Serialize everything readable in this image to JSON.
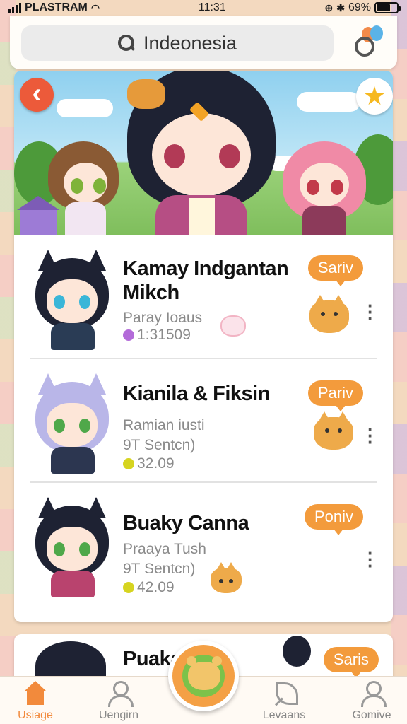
{
  "status_bar": {
    "carrier": "PLASTRAM",
    "time": "11:31",
    "battery": "69%",
    "battery_level": 0.69
  },
  "search": {
    "value": "Indeonesia",
    "icon": "search-icon"
  },
  "header": {
    "action_icon": "balloon-search-icon"
  },
  "hero": {
    "back_icon": "back-arrow-icon",
    "favorite_icon": "star-icon"
  },
  "items": [
    {
      "name": "Kamay Indgantan Mikch",
      "subtitle": "Paray Ioaus",
      "detail": "",
      "value": "1:31509",
      "badge": "Sariv",
      "dot_color": "#b36bd9",
      "hair_color": "#1e2233",
      "eye_color": "#3ab6d8",
      "body_color": "#2a3c55"
    },
    {
      "name": "Kianila & Fiksin",
      "subtitle": "Ramian iusti",
      "detail": "9T  Sentcn)",
      "value": "32.09",
      "badge": "Pariv",
      "dot_color": "#d6d420",
      "hair_color": "#b9b6e8",
      "eye_color": "#4fa84a",
      "body_color": "#2c3650"
    },
    {
      "name": "Buaky Canna",
      "subtitle": "Praaya Tush",
      "detail": "9T  Sentcn)",
      "value": "42.09",
      "badge": "Poniv",
      "dot_color": "#d6d420",
      "hair_color": "#1e2233",
      "eye_color": "#4fa84a",
      "body_color": "#b9436e"
    }
  ],
  "partial_item": {
    "name": "Puaka",
    "badge": "Saris"
  },
  "nav": [
    {
      "label": "Usiage",
      "icon": "home-icon",
      "active": true
    },
    {
      "label": "Uengirn",
      "icon": "user-icon",
      "active": false
    },
    {
      "label": "",
      "icon": "pet-center-icon",
      "active": false
    },
    {
      "label": "Levaans",
      "icon": "leaf-icon",
      "active": false
    },
    {
      "label": "Gomive",
      "icon": "profile-icon",
      "active": false
    }
  ],
  "colors": {
    "accent": "#f39b3c",
    "active_nav": "#f28a3c",
    "back_button": "#ec5a3a"
  }
}
